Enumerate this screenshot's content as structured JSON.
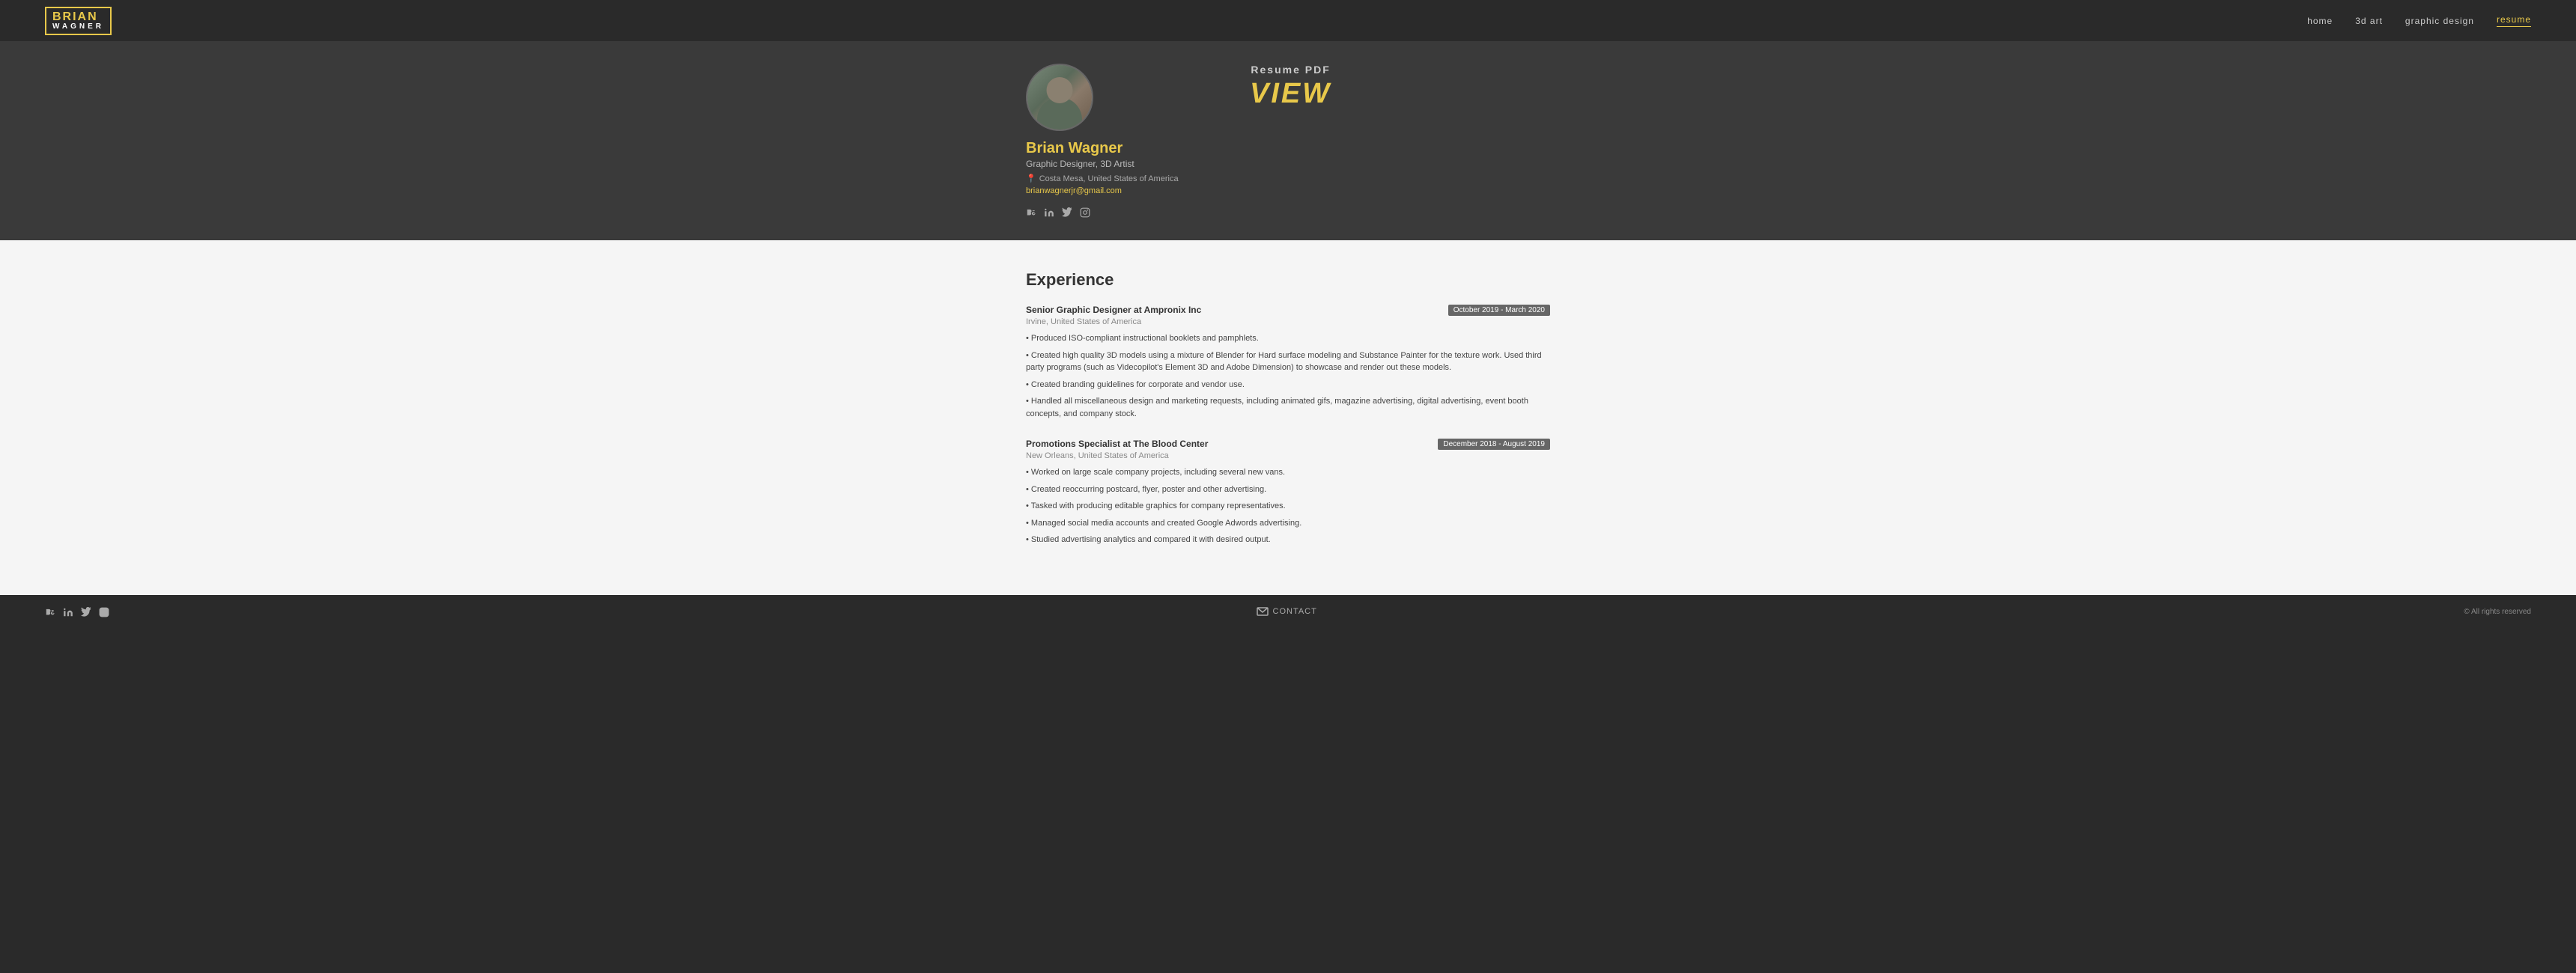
{
  "nav": {
    "logo_line1": "BRIAN",
    "logo_line2": "WAGNER",
    "links": [
      {
        "label": "home",
        "href": "#",
        "active": false
      },
      {
        "label": "3d art",
        "href": "#",
        "active": false
      },
      {
        "label": "graphic design",
        "href": "#",
        "active": false
      },
      {
        "label": "resume",
        "href": "#",
        "active": true
      }
    ]
  },
  "profile": {
    "name": "Brian Wagner",
    "title": "Graphic Designer, 3D Artist",
    "location": "Costa Mesa, United States of America",
    "email": "brianwagnerjr@gmail.com",
    "resume_pdf_label": "Resume PDF",
    "resume_view_label": "VIEW"
  },
  "experience": {
    "section_title": "Experience",
    "jobs": [
      {
        "title": "Senior Graphic Designer at Ampronix Inc",
        "location": "Irvine, United States of America",
        "dates": "October 2019 - March 2020",
        "bullets": [
          "• Produced ISO-compliant instructional booklets and pamphlets.",
          "• Created high quality 3D models using a mixture of Blender for Hard surface modeling and Substance Painter for the texture work. Used third party programs (such as Videcopilot's Element 3D and Adobe Dimension) to showcase and render out these models.",
          "• Created branding guidelines for corporate and vendor use.",
          "• Handled all miscellaneous design and marketing requests, including animated gifs, magazine advertising, digital advertising, event booth concepts, and company stock."
        ]
      },
      {
        "title": "Promotions Specialist at The Blood Center",
        "location": "New Orleans, United States of America",
        "dates": "December 2018 - August 2019",
        "bullets": [
          "• Worked on large scale company projects, including several new vans.",
          "• Created reoccurring postcard, flyer, poster and other advertising.",
          "• Tasked with producing editable graphics for company representatives.",
          "• Managed social media accounts and created Google Adwords advertising.",
          "• Studied advertising analytics and compared it with desired output."
        ]
      }
    ]
  },
  "footer": {
    "contact_label": "CONTACT",
    "copyright": "© All rights reserved"
  }
}
